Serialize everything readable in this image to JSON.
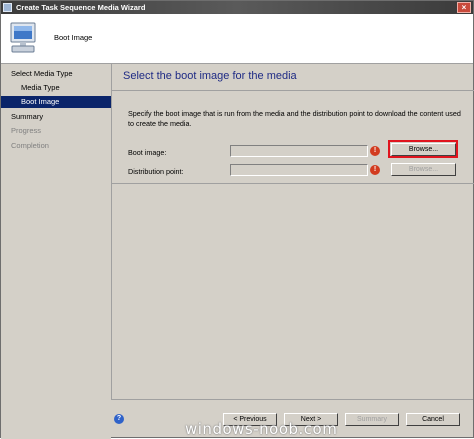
{
  "window": {
    "title": "Create Task Sequence Media Wizard"
  },
  "header": {
    "title": "Boot Image",
    "icon": "computer-icon"
  },
  "sidebar": {
    "items": [
      {
        "label": "Select Media Type",
        "state": "normal"
      },
      {
        "label": "Media Type",
        "state": "normal"
      },
      {
        "label": "Boot Image",
        "state": "active"
      },
      {
        "label": "Summary",
        "state": "normal"
      },
      {
        "label": "Progress",
        "state": "disabled"
      },
      {
        "label": "Completion",
        "state": "disabled"
      }
    ]
  },
  "content": {
    "title": "Select the boot image for the media",
    "description": "Specify the boot image that is run from the media and the distribution point to download the content used to create the media.",
    "boot_image": {
      "label": "Boot image:",
      "value": "",
      "button": "Browse..."
    },
    "distribution_point": {
      "label": "Distribution point:",
      "value": "",
      "button": "Browse..."
    }
  },
  "footer": {
    "previous": "< Previous",
    "next": "Next >",
    "summary": "Summary",
    "cancel": "Cancel"
  },
  "watermark": "windows-noob.com",
  "colors": {
    "accent": "#0a246a",
    "title_text": "#1f2b85",
    "highlight": "#e0141e",
    "error": "#d23b1f"
  }
}
